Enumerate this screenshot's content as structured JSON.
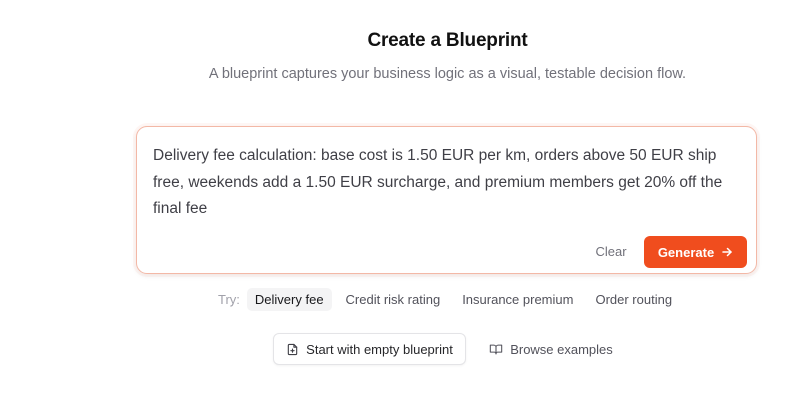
{
  "header": {
    "title": "Create a Blueprint",
    "subtitle": "A blueprint captures your business logic as a visual, testable decision flow."
  },
  "composer": {
    "text": "Delivery fee calculation: base cost is 1.50 EUR per km, orders above 50 EUR ship free, weekends add a 1.50 EUR surcharge, and premium members get 20% off the final fee",
    "clear_label": "Clear",
    "generate_label": "Generate",
    "generate_icon": "arrow-right-icon"
  },
  "suggestions": {
    "label": "Try:",
    "chips": [
      {
        "label": "Delivery fee",
        "selected": true
      },
      {
        "label": "Credit risk rating",
        "selected": false
      },
      {
        "label": "Insurance premium",
        "selected": false
      },
      {
        "label": "Order routing",
        "selected": false
      }
    ]
  },
  "actions": {
    "empty_label": "Start with empty blueprint",
    "empty_icon": "file-plus-icon",
    "browse_label": "Browse examples",
    "browse_icon": "book-open-icon"
  },
  "colors": {
    "accent": "#f04d1e",
    "composer_border": "#f3b8a6"
  }
}
